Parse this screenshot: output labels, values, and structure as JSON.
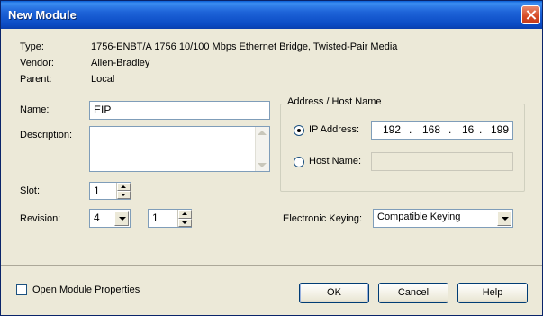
{
  "window": {
    "title": "New Module"
  },
  "info": {
    "type_label": "Type:",
    "type_value": "1756-ENBT/A 1756 10/100 Mbps Ethernet Bridge, Twisted-Pair Media",
    "vendor_label": "Vendor:",
    "vendor_value": "Allen-Bradley",
    "parent_label": "Parent:",
    "parent_value": "Local"
  },
  "form": {
    "name_label": "Name:",
    "name_value": "EIP",
    "description_label": "Description:",
    "description_value": "",
    "slot_label": "Slot:",
    "slot_value": "1",
    "revision_label": "Revision:",
    "revision_major": "4",
    "revision_minor": "1"
  },
  "address": {
    "group_label": "Address / Host Name",
    "ip_label": "IP Address:",
    "ip_octets": [
      "192",
      "168",
      "16",
      "199"
    ],
    "ip_selected": true,
    "host_label": "Host Name:",
    "host_value": ""
  },
  "keying": {
    "label": "Electronic Keying:",
    "value": "Compatible Keying"
  },
  "footer": {
    "open_props_label": "Open Module Properties",
    "ok_label": "OK",
    "cancel_label": "Cancel",
    "help_label": "Help"
  }
}
